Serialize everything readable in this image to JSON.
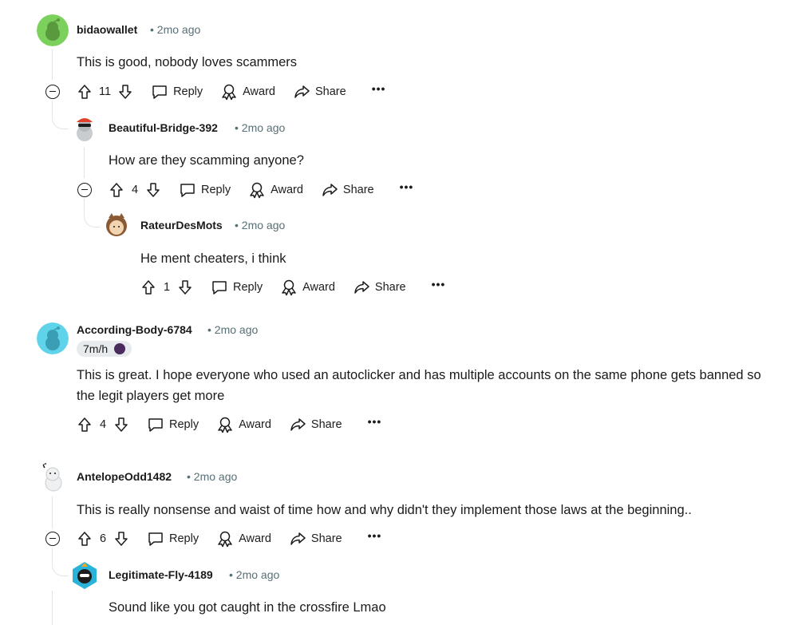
{
  "comments": [
    {
      "username": "bidaowallet",
      "time": "2mo ago",
      "text": "This is good, nobody loves scammers",
      "votes": "11"
    },
    {
      "username": "Beautiful-Bridge-392",
      "time": "2mo ago",
      "text": "How are they scamming anyone?",
      "votes": "4"
    },
    {
      "username": "RateurDesMots",
      "time": "2mo ago",
      "text": "He ment cheaters, i think",
      "votes": "1"
    },
    {
      "username": "According-Body-6784",
      "time": "2mo ago",
      "flair": "7m/h",
      "text": "This is great. I hope everyone who used an autoclicker and has multiple accounts on the same phone gets banned so the legit players get more",
      "votes": "4"
    },
    {
      "username": "AntelopeOdd1482",
      "time": "2mo ago",
      "text": "This is really nonsense and waist of time how and why didn't they implement those laws at the beginning..",
      "votes": "6"
    },
    {
      "username": "Legitimate-Fly-4189",
      "time": "2mo ago",
      "text": "Sound like you got caught in the crossfire Lmao"
    }
  ],
  "actions": {
    "reply": "Reply",
    "award": "Award",
    "share": "Share",
    "more": "•••",
    "separator": "•"
  },
  "icons": {
    "upvote": "arrow-up-icon",
    "downvote": "arrow-down-icon",
    "reply": "speech-bubble-icon",
    "award": "award-ribbon-icon",
    "share": "share-arrow-icon",
    "collapse": "minus-circle-icon"
  },
  "colors": {
    "text": "#1a1a1b",
    "meta": "#576f76",
    "thread_line": "#e0e4e6",
    "flair_bg": "#e8ebed",
    "avatar_green": "#7bd15c",
    "avatar_cyan": "#5fd3e9"
  }
}
